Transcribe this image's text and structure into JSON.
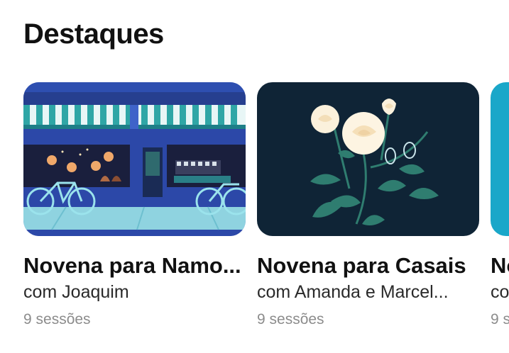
{
  "section": {
    "title": "Destaques"
  },
  "cards": [
    {
      "title": "Novena para Namo...",
      "subtitle": "com Joaquim",
      "sessions": "9 sessões",
      "image": "storefront-illustration"
    },
    {
      "title": "Novena para Casais",
      "subtitle": "com Amanda e Marcel...",
      "sessions": "9 sessões",
      "image": "white-roses-illustration"
    },
    {
      "title": "No",
      "subtitle": "co",
      "sessions": "9 s",
      "image": "teal-illustration"
    }
  ],
  "colors": {
    "card1_bg": "#3f63c9",
    "card2_bg": "#0f2436",
    "card3_bg": "#1aa7c9",
    "meta_text": "#8c8c8c"
  }
}
